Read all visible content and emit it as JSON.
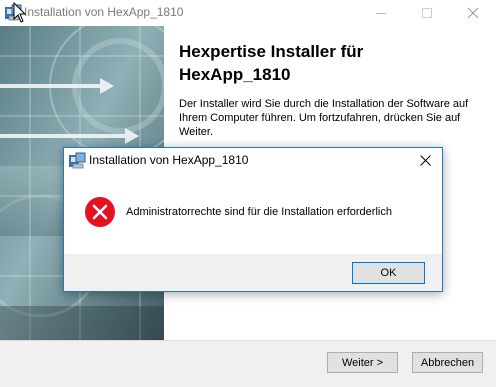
{
  "window": {
    "title": "Installation von HexApp_1810",
    "buttons": {
      "minimize": "minimize-icon",
      "maximize": "maximize-icon",
      "close": "close-icon"
    }
  },
  "welcome": {
    "heading": "Hexpertise Installer für HexApp_1810",
    "body": "Der Installer wird Sie durch die Installation der Software auf Ihrem Computer führen. Um fortzufahren, drücken Sie auf Weiter."
  },
  "footer": {
    "next_label": "Weiter >",
    "cancel_label": "Abbrechen"
  },
  "dialog": {
    "title": "Installation von HexApp_1810",
    "message": "Administratorrechte sind für die Installation erforderlich",
    "ok_label": "OK",
    "icon": "error-icon"
  },
  "colors": {
    "dialog_border": "#1e79c9",
    "error_red": "#e81123",
    "footer_bg": "#f0f0f0",
    "button_bg": "#e1e1e1",
    "focus_blue": "#0078d7"
  }
}
